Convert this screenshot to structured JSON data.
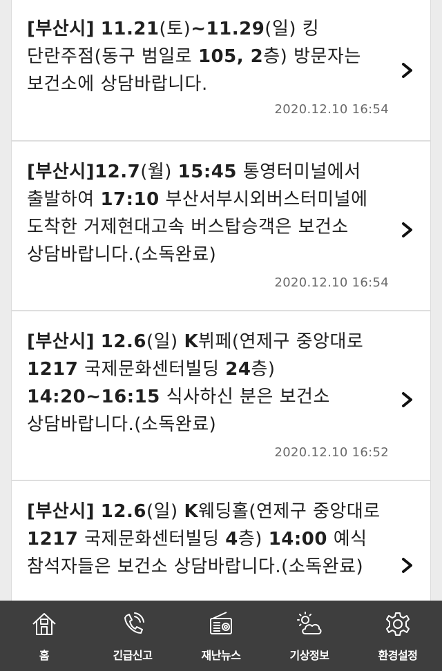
{
  "messages": [
    {
      "region": "[부산시]",
      "parts": [
        {
          "t": " ",
          "b": false
        },
        {
          "t": "11.21",
          "b": true
        },
        {
          "t": "(토)",
          "b": false
        },
        {
          "t": "~11.29",
          "b": true
        },
        {
          "t": "(일) 킹 단란주점(동구 범일로 ",
          "b": false
        },
        {
          "t": "105, 2",
          "b": true
        },
        {
          "t": "층) 방문자는 보건소에 상담바랍니다.",
          "b": false
        }
      ],
      "date": "2020.12.10 16:54"
    },
    {
      "region": "[부산시]",
      "parts": [
        {
          "t": "12.7",
          "b": true
        },
        {
          "t": "(월) ",
          "b": false
        },
        {
          "t": "15:45",
          "b": true
        },
        {
          "t": " 통영터미널에서 출발하여 ",
          "b": false
        },
        {
          "t": "17:10",
          "b": true
        },
        {
          "t": " 부산서부시외버스터미널에 도착한 거제현대고속 버스탑승객은 보건소 상담바랍니다.(소독완료)",
          "b": false
        }
      ],
      "date": "2020.12.10 16:54"
    },
    {
      "region": "[부산시]",
      "parts": [
        {
          "t": " ",
          "b": false
        },
        {
          "t": "12.6",
          "b": true
        },
        {
          "t": "(일) ",
          "b": false
        },
        {
          "t": "K",
          "b": true
        },
        {
          "t": "뷔페(연제구 중앙대로 ",
          "b": false
        },
        {
          "t": "1217",
          "b": true
        },
        {
          "t": " 국제문화센터빌딩 ",
          "b": false
        },
        {
          "t": "24",
          "b": true
        },
        {
          "t": "층) ",
          "b": false
        },
        {
          "t": "14:20~16:15",
          "b": true
        },
        {
          "t": " 식사하신 분은 보건소 상담바랍니다.(소독완료)",
          "b": false
        }
      ],
      "date": "2020.12.10 16:52"
    },
    {
      "region": "[부산시]",
      "parts": [
        {
          "t": " ",
          "b": false
        },
        {
          "t": "12.6",
          "b": true
        },
        {
          "t": "(일) ",
          "b": false
        },
        {
          "t": "K",
          "b": true
        },
        {
          "t": "웨딩홀(연제구 중앙대로 ",
          "b": false
        },
        {
          "t": "1217",
          "b": true
        },
        {
          "t": " 국제문화센터빌딩 ",
          "b": false
        },
        {
          "t": "4",
          "b": true
        },
        {
          "t": "층) ",
          "b": false
        },
        {
          "t": "14:00",
          "b": true
        },
        {
          "t": " 예식 참석자들은 보건소 상담바랍니다.(소독완료)",
          "b": false
        }
      ],
      "date": ""
    }
  ],
  "tabbar": {
    "items": [
      {
        "label": "홈",
        "icon": "home-icon"
      },
      {
        "label": "긴급신고",
        "icon": "phone-icon"
      },
      {
        "label": "재난뉴스",
        "icon": "radio-icon"
      },
      {
        "label": "기상정보",
        "icon": "weather-icon"
      },
      {
        "label": "환경설정",
        "icon": "gear-icon"
      }
    ]
  },
  "colors": {
    "tabbar_bg": "#3e3e3e",
    "text": "#1f1f1f",
    "date": "#6a6a6a"
  }
}
